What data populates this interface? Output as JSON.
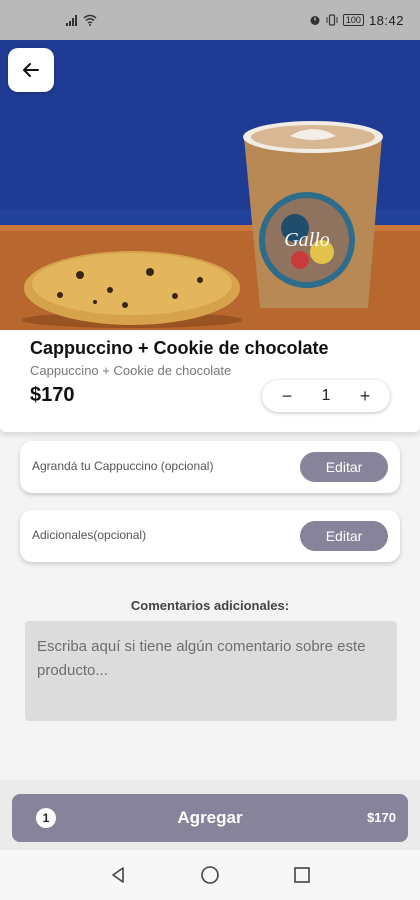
{
  "status_bar": {
    "time": "18:42",
    "battery": "100"
  },
  "product": {
    "title": "Cappuccino + Cookie de chocolate",
    "subtitle": "Cappuccino + Cookie de chocolate",
    "price": "$170"
  },
  "quantity": {
    "minus": "−",
    "value": "1",
    "plus": "+"
  },
  "options": [
    {
      "label": "Agrandá tu Cappuccino  (opcional)",
      "button": "Editar"
    },
    {
      "label": "Adicionales(opcional)",
      "button": "Editar"
    }
  ],
  "comments": {
    "title": "Comentarios adicionales:",
    "placeholder": "Escriba aquí si tiene algún comentario sobre este producto..."
  },
  "add_button": {
    "count": "1",
    "label": "Agregar",
    "total": "$170"
  },
  "colors": {
    "accent": "#87839a",
    "hero_bg": "#1f3b94",
    "table": "#b8672e"
  },
  "icons": {
    "back": "arrow-left-icon",
    "nav_back": "triangle-back-icon",
    "nav_home": "circle-home-icon",
    "nav_recents": "square-recents-icon"
  }
}
